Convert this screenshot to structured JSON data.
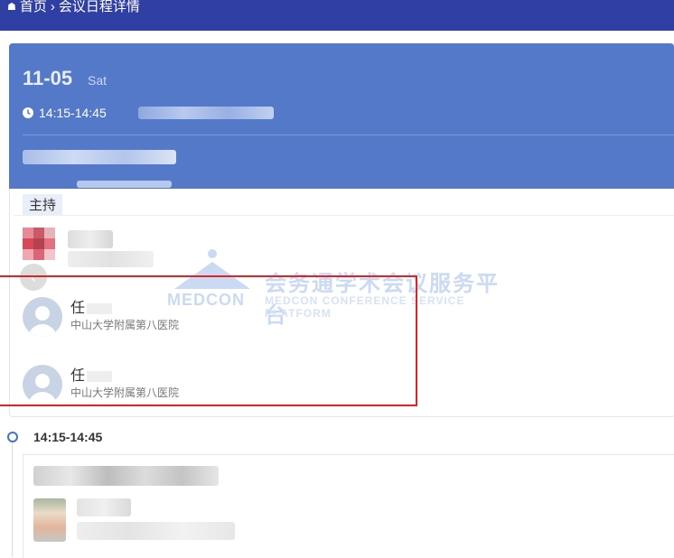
{
  "breadcrumb": {
    "home": "首页",
    "separator": "›",
    "current": "会议日程详情"
  },
  "session": {
    "date": "11-05",
    "weekday": "Sat",
    "time": "14:15-14:45"
  },
  "host_section": {
    "label": "主持"
  },
  "watermark": {
    "logo": "MEDCON",
    "cn": "会务通学术会议服务平台",
    "en": "MEDCON CONFERENCE SERVICE PLATFORM"
  },
  "speakers": [
    {
      "surname": "任",
      "org": "中山大学附属第八医院"
    },
    {
      "surname": "任",
      "org": "中山大学附属第八医院"
    }
  ],
  "next_session": {
    "time": "14:15-14:45"
  },
  "icons": {
    "home": "home-icon",
    "clock": "clock-icon",
    "arrow": "chevron-left-icon"
  },
  "colors": {
    "topbar": "#2f3fa3",
    "banner": "#5479c9",
    "highlight": "#e02222"
  }
}
